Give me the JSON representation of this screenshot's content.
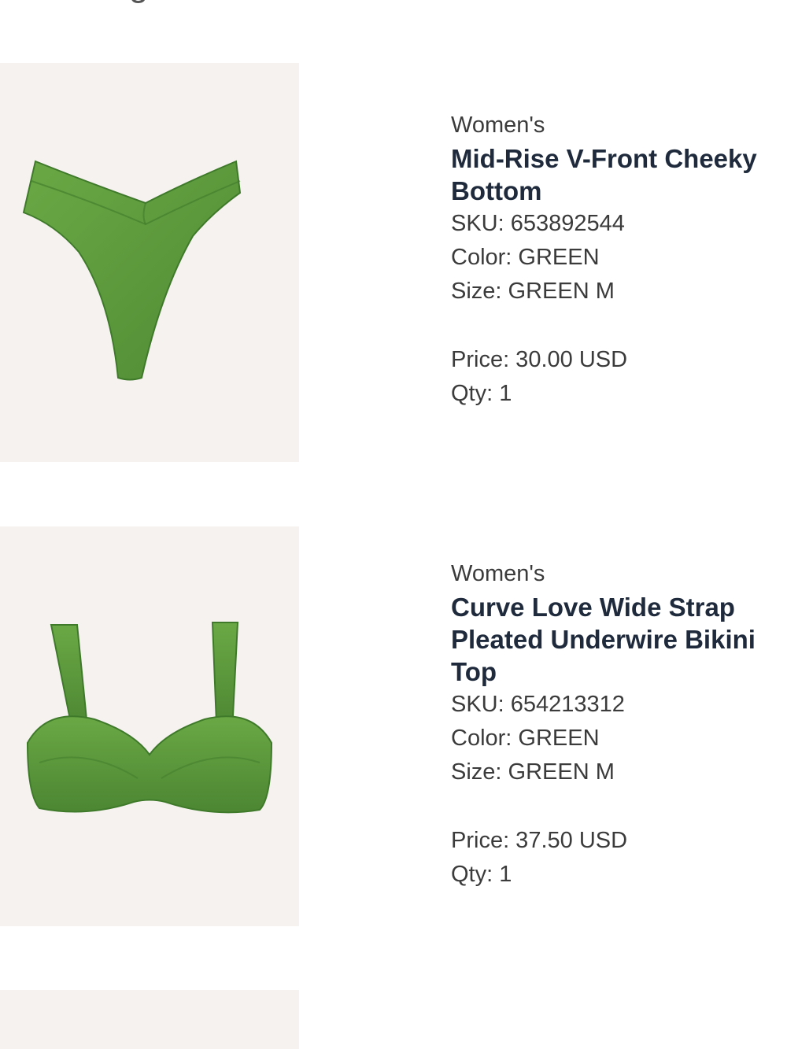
{
  "page": {
    "heading_fragment": "rocessing"
  },
  "items": [
    {
      "gender": "Women's",
      "name": "Mid-Rise V-Front Cheeky Bottom",
      "sku": "SKU: 653892544",
      "color": "Color: GREEN",
      "size": "Size: GREEN M",
      "price": "Price: 30.00 USD",
      "qty": "Qty: 1",
      "image_icon": "bikini-bottom-image",
      "product_color": "#5a9a3a"
    },
    {
      "gender": "Women's",
      "name": "Curve Love Wide Strap Pleated Underwire Bikini Top",
      "sku": "SKU: 654213312",
      "color": "Color: GREEN",
      "size": "Size: GREEN M",
      "price": "Price: 37.50 USD",
      "qty": "Qty: 1",
      "image_icon": "bikini-top-image",
      "product_color": "#5a9a3a"
    }
  ]
}
